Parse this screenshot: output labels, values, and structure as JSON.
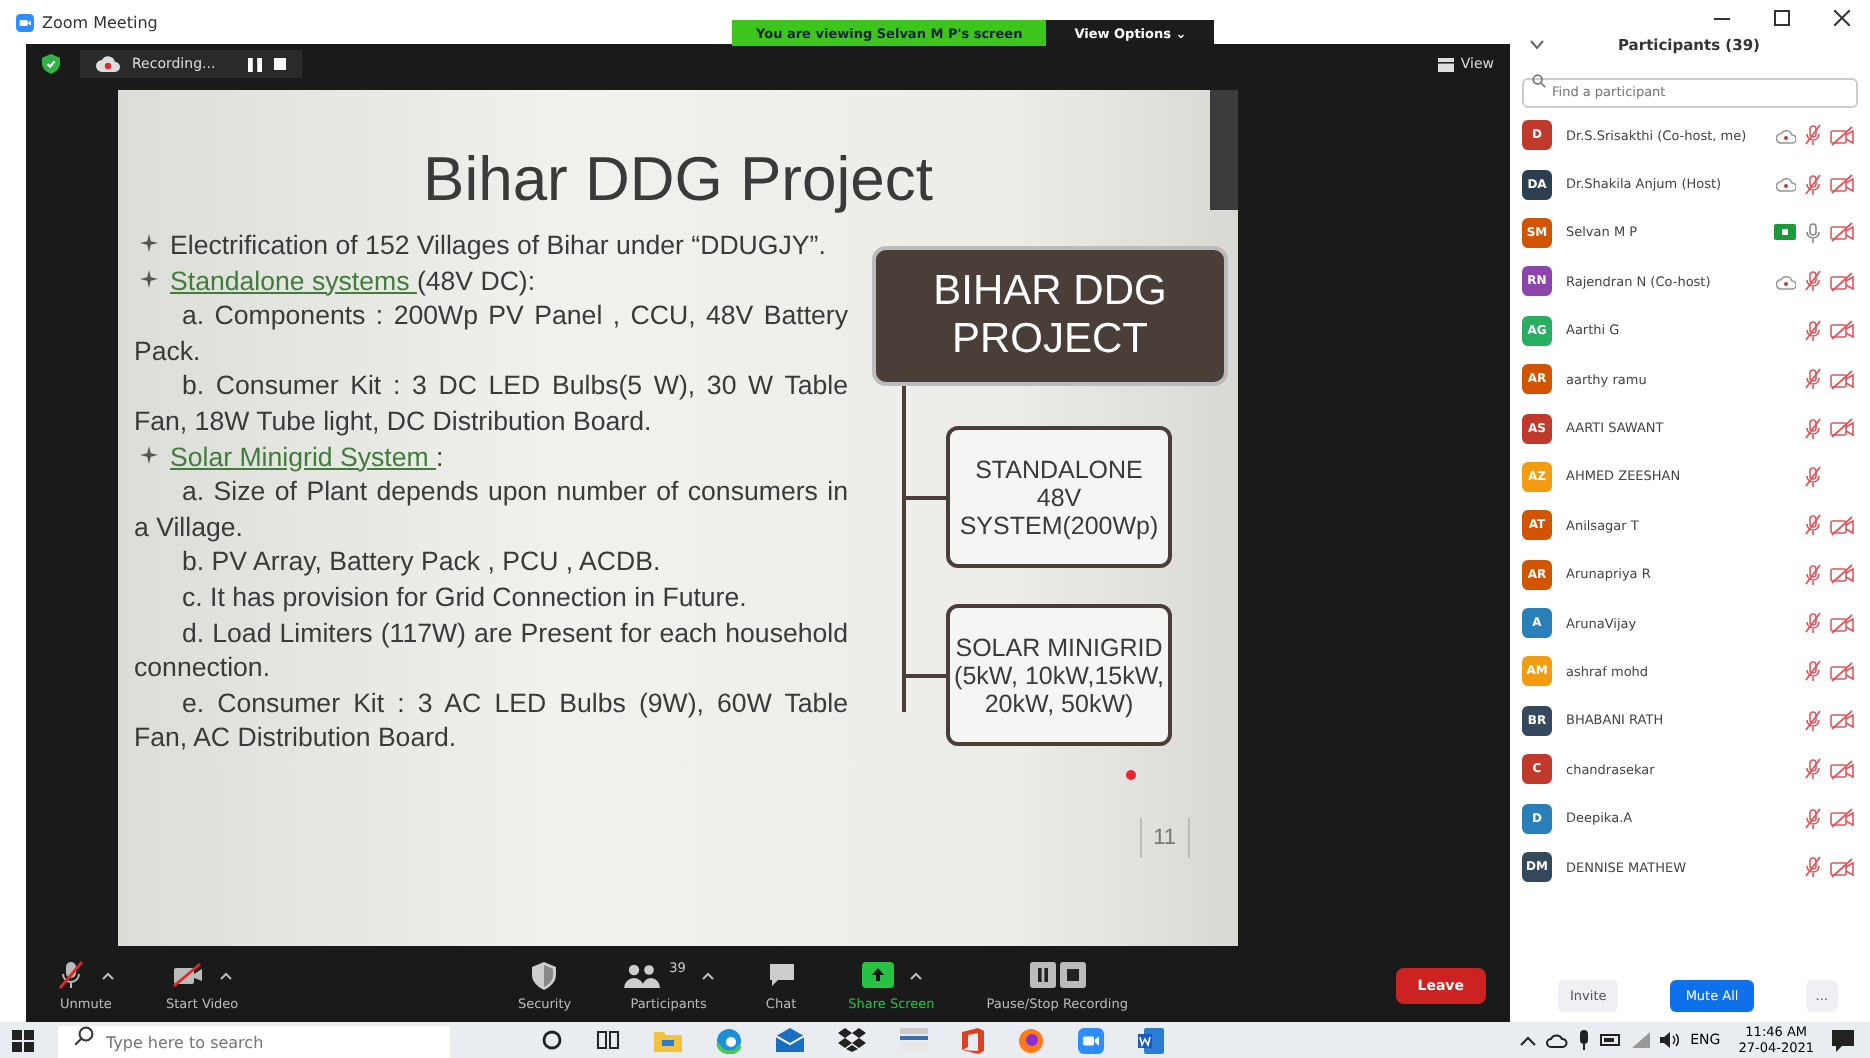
{
  "window": {
    "title": "Zoom Meeting",
    "banner": "You are viewing Selvan M P's screen",
    "view_options": "View Options ⌄"
  },
  "meeting_bar": {
    "recording_label": "Recording...",
    "view_label": "View"
  },
  "slide": {
    "title": "Bihar DDG Project",
    "lines": [
      {
        "kind": "bullet",
        "text": "Electrification of 152 Villages of Bihar under “DDUGJY”."
      },
      {
        "kind": "bullet",
        "underlined": "Standalone systems ",
        "text": "(48V DC):"
      },
      {
        "kind": "item",
        "text": "a. Components   : 200Wp PV Panel , CCU, 48V Battery Pack."
      },
      {
        "kind": "item",
        "text": "b. Consumer Kit : 3 DC LED Bulbs(5 W), 30 W Table Fan,   18W Tube light,  DC Distribution Board."
      },
      {
        "kind": "bullet",
        "underlined": "Solar Minigrid System ",
        "text": ":"
      },
      {
        "kind": "item",
        "text": "a.  Size of Plant depends upon number of consumers in a Village."
      },
      {
        "kind": "item",
        "text": "b.  PV Array, Battery Pack , PCU , ACDB."
      },
      {
        "kind": "item",
        "text": "c.   It has provision for Grid Connection in Future."
      },
      {
        "kind": "item",
        "text": "d.  Load  Limiters  (117W)  are  Present    for  each household connection."
      },
      {
        "kind": "item",
        "text": "e. Consumer Kit : 3 AC LED Bulbs (9W), 60W Table Fan, AC Distribution  Board."
      }
    ],
    "diagram": {
      "root": "BIHAR DDG PROJECT",
      "children": [
        "STANDALONE 48V SYSTEM(200Wp)",
        "SOLAR MINIGRID (5kW, 10kW,15kW, 20kW, 50kW)"
      ]
    },
    "page_number": "11"
  },
  "toolbar": {
    "items": [
      {
        "kind": "mic",
        "label": "Unmute"
      },
      {
        "kind": "video",
        "label": "Start Video"
      },
      {
        "kind": "security",
        "label": "Security"
      },
      {
        "kind": "participants",
        "label": "Participants",
        "count": "39"
      },
      {
        "kind": "chat",
        "label": "Chat"
      },
      {
        "kind": "share",
        "label": "Share Screen"
      },
      {
        "kind": "record",
        "label": "Pause/Stop Recording"
      }
    ],
    "leave": "Leave"
  },
  "participants": {
    "title": "Participants (39)",
    "search": {
      "placeholder": "Find a participant"
    },
    "rows": [
      {
        "initials": "D",
        "name": "Dr.S.Srisakthi (Co-host, me)",
        "color": "#c0392b",
        "recording": true,
        "sharing": false,
        "muted": true,
        "video_off": true
      },
      {
        "initials": "DA",
        "name": "Dr.Shakila Anjum (Host)",
        "color": "#2c3e50",
        "recording": true,
        "sharing": false,
        "muted": true,
        "video_off": true
      },
      {
        "initials": "SM",
        "name": "Selvan M P",
        "color": "#d35400",
        "recording": false,
        "sharing": true,
        "muted": false,
        "video_off": true
      },
      {
        "initials": "RN",
        "name": "Rajendran N (Co-host)",
        "color": "#8e44ad",
        "recording": true,
        "sharing": false,
        "muted": true,
        "video_off": true
      },
      {
        "initials": "AG",
        "name": "Aarthi G",
        "color": "#27ae60",
        "recording": false,
        "sharing": false,
        "muted": true,
        "video_off": true
      },
      {
        "initials": "AR",
        "name": "aarthy ramu",
        "color": "#d35400",
        "recording": false,
        "sharing": false,
        "muted": true,
        "video_off": true
      },
      {
        "initials": "AS",
        "name": "AARTI SAWANT",
        "color": "#c0392b",
        "recording": false,
        "sharing": false,
        "muted": true,
        "video_off": true
      },
      {
        "initials": "AZ",
        "name": "AHMED ZEESHAN",
        "color": "#f39c12",
        "recording": false,
        "sharing": false,
        "muted": true,
        "video_off": false
      },
      {
        "initials": "AT",
        "name": "Anilsagar T",
        "color": "#d35400",
        "recording": false,
        "sharing": false,
        "muted": true,
        "video_off": true
      },
      {
        "initials": "AR",
        "name": "Arunapriya R",
        "color": "#d35400",
        "recording": false,
        "sharing": false,
        "muted": true,
        "video_off": true
      },
      {
        "initials": "A",
        "name": "ArunaVijay",
        "color": "#2980b9",
        "recording": false,
        "sharing": false,
        "muted": true,
        "video_off": true
      },
      {
        "initials": "AM",
        "name": "ashraf mohd",
        "color": "#f39c12",
        "recording": false,
        "sharing": false,
        "muted": true,
        "video_off": true
      },
      {
        "initials": "BR",
        "name": "BHABANI RATH",
        "color": "#34495e",
        "recording": false,
        "sharing": false,
        "muted": true,
        "video_off": true
      },
      {
        "initials": "C",
        "name": "chandrasekar",
        "color": "#c0392b",
        "recording": false,
        "sharing": false,
        "muted": true,
        "video_off": true
      },
      {
        "initials": "D",
        "name": "Deepika.A",
        "color": "#2980b9",
        "recording": false,
        "sharing": false,
        "muted": true,
        "video_off": true
      },
      {
        "initials": "DM",
        "name": "DENNISE MATHEW",
        "color": "#34495e",
        "recording": false,
        "sharing": false,
        "muted": true,
        "video_off": true
      }
    ],
    "buttons": {
      "invite": "Invite",
      "mute_all": "Mute All",
      "more": "..."
    }
  },
  "taskbar": {
    "search": {
      "placeholder": "Type here to search"
    },
    "language": "ENG",
    "time": "11:46 AM",
    "date": "27-04-2021"
  }
}
